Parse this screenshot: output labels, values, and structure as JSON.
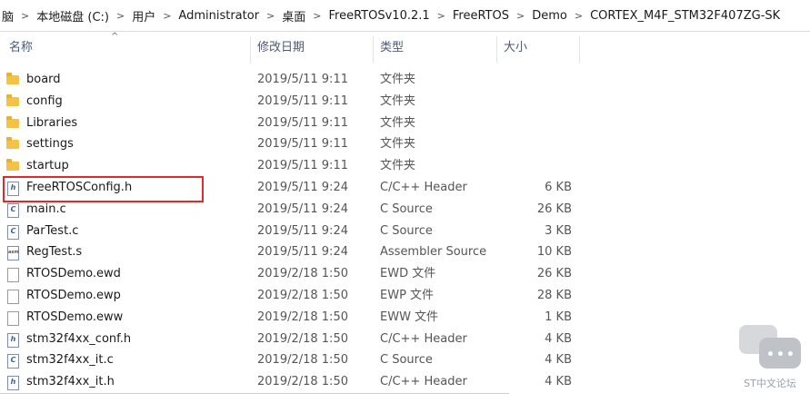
{
  "breadcrumb": [
    "脑",
    "本地磁盘 (C:)",
    "用户",
    "Administrator",
    "桌面",
    "FreeRTOSv10.2.1",
    "FreeRTOS",
    "Demo",
    "CORTEX_M4F_STM32F407ZG-SK"
  ],
  "columns": {
    "name": "名称",
    "date": "修改日期",
    "type": "类型",
    "size": "大小"
  },
  "files": [
    {
      "icon": "folder-icon",
      "name": "board",
      "date": "2019/5/11 9:11",
      "type": "文件夹",
      "size": ""
    },
    {
      "icon": "folder-icon",
      "name": "config",
      "date": "2019/5/11 9:11",
      "type": "文件夹",
      "size": ""
    },
    {
      "icon": "folder-icon",
      "name": "Libraries",
      "date": "2019/5/11 9:11",
      "type": "文件夹",
      "size": ""
    },
    {
      "icon": "folder-icon",
      "name": "settings",
      "date": "2019/5/11 9:11",
      "type": "文件夹",
      "size": ""
    },
    {
      "icon": "folder-icon",
      "name": "startup",
      "date": "2019/5/11 9:11",
      "type": "文件夹",
      "size": ""
    },
    {
      "icon": "h-file-icon",
      "name": "FreeRTOSConfig.h",
      "date": "2019/5/11 9:24",
      "type": "C/C++ Header",
      "size": "6 KB"
    },
    {
      "icon": "c-file-icon",
      "name": "main.c",
      "date": "2019/5/11 9:24",
      "type": "C Source",
      "size": "26 KB"
    },
    {
      "icon": "c-file-icon",
      "name": "ParTest.c",
      "date": "2019/5/11 9:24",
      "type": "C Source",
      "size": "3 KB"
    },
    {
      "icon": "asm-file-icon",
      "name": "RegTest.s",
      "date": "2019/5/11 9:24",
      "type": "Assembler Source",
      "size": "10 KB"
    },
    {
      "icon": "plain-file-icon",
      "name": "RTOSDemo.ewd",
      "date": "2019/2/18 1:50",
      "type": "EWD 文件",
      "size": "26 KB"
    },
    {
      "icon": "plain-file-icon",
      "name": "RTOSDemo.ewp",
      "date": "2019/2/18 1:50",
      "type": "EWP 文件",
      "size": "28 KB"
    },
    {
      "icon": "plain-file-icon",
      "name": "RTOSDemo.eww",
      "date": "2019/2/18 1:50",
      "type": "EWW 文件",
      "size": "1 KB"
    },
    {
      "icon": "h-file-icon",
      "name": "stm32f4xx_conf.h",
      "date": "2019/2/18 1:50",
      "type": "C/C++ Header",
      "size": "4 KB"
    },
    {
      "icon": "c-file-icon",
      "name": "stm32f4xx_it.c",
      "date": "2019/2/18 1:50",
      "type": "C Source",
      "size": "4 KB"
    },
    {
      "icon": "h-file-icon",
      "name": "stm32f4xx_it.h",
      "date": "2019/2/18 1:50",
      "type": "C/C++ Header",
      "size": "4 KB"
    }
  ],
  "icon_glyphs": {
    "h": "h",
    "c": "C",
    "asm": "asm"
  },
  "watermark_text": "ST中文论坛",
  "colors": {
    "highlight": "#e02b2b",
    "folder": "#f4c247",
    "header_text": "#4a5a78"
  }
}
